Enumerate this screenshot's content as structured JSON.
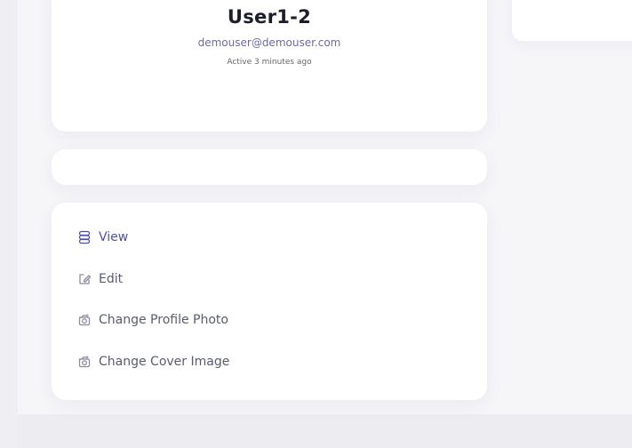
{
  "profile": {
    "name": "User1-2",
    "email": "demouser@demouser.com",
    "active_status": "Active 3 minutes ago"
  },
  "actions": {
    "items": [
      {
        "label": "View",
        "icon": "view-icon"
      },
      {
        "label": "Edit",
        "icon": "edit-icon"
      },
      {
        "label": "Change Profile Photo",
        "icon": "camera-icon"
      },
      {
        "label": "Change Cover Image",
        "icon": "camera-icon"
      }
    ]
  },
  "colors": {
    "primary_link": "#4b4fae",
    "secondary_link": "#5a5a72",
    "email_text": "#6b6ba8",
    "background": "#f6f6f9",
    "card": "#ffffff"
  }
}
